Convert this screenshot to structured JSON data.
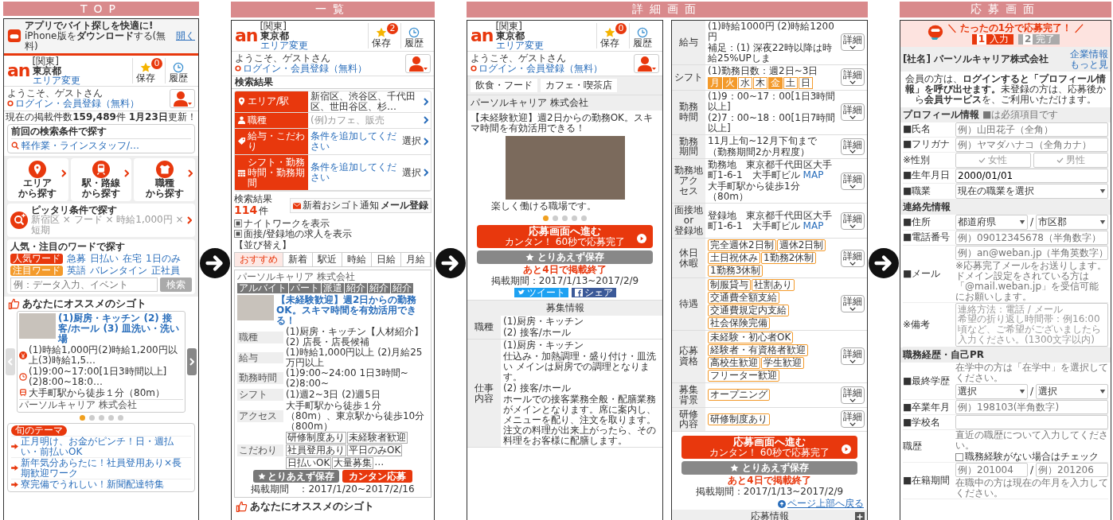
{
  "top": {
    "heading": "TOP",
    "app_banner": {
      "title": "**アプリ**でバイト探しを快適に!",
      "subtitle": "iPhone版を**ダウンロード**する(無料)",
      "open_link": "開く"
    },
    "header": {
      "logo": "an",
      "region": "[関東]",
      "prefecture": "東京都",
      "change_area": "エリア変更",
      "saved_count": "0",
      "saved_label": "保存",
      "history_label": "履歴"
    },
    "welcome": {
      "greeting": "ようこそ、ゲストさん",
      "login_link": "ログイン・会員登録（無料）"
    },
    "listing_count": "現在の掲載件数**159,489**件 **1月23日**更新！",
    "previous_search": {
      "title": "前回の検索条件で探す",
      "link": "軽作業・ラインスタッフ/…"
    },
    "search_tiles": [
      {
        "kind": "area",
        "lines": [
          "エリア",
          "から探す"
        ]
      },
      {
        "kind": "station",
        "lines": [
          "駅・路線",
          "から探す"
        ]
      },
      {
        "kind": "job",
        "lines": [
          "職種",
          "から探す"
        ]
      }
    ],
    "match_search": {
      "title": "ピッタリ条件で探す",
      "example": "新宿区 × フード × 時給1,000円 × 短期"
    },
    "popular_words": {
      "title": "人気・注目のワードで探す",
      "groups": [
        {
          "label": "人気ワード",
          "color": "#e8380d",
          "words": [
            "急募",
            "日払い",
            "在宅",
            "1日のみ"
          ]
        },
        {
          "label": "注目ワード",
          "color": "#f39a2b",
          "words": [
            "英語",
            "バレンタイン",
            "正社員"
          ]
        }
      ],
      "placeholder": "例：データ入力、イベント",
      "button": "検索"
    },
    "recommend": {
      "title": "あなたにオススメのシゴト",
      "job_title": "(1)厨房・キッチン (2) 接客/ホール (3) 皿洗い・洗い場",
      "info": [
        {
          "kind": "pay",
          "text": "(1)時給1,000円(2)時給1,200円以上(3)時給1,5…"
        },
        {
          "kind": "time",
          "text": "(1)9:00~17:00[1日3時間以上](2)8:00~18:0…"
        },
        {
          "kind": "access",
          "text": "大手町駅から徒歩１分（80m）"
        }
      ],
      "company": "パーソルキャリア 株式会社",
      "dots": [
        {
          "selected": true
        },
        {
          "selected": false
        },
        {
          "selected": false
        },
        {
          "selected": false
        },
        {
          "selected": false
        }
      ]
    },
    "themes": {
      "title": "旬のテーマ",
      "items": [
        "正月明け、お金がピンチ！日・週払い・前払いOK",
        "新年気分あらたに！社員登用あり×長期歓迎ワーク",
        "寮完備でうれしい！新聞配達特集"
      ]
    }
  },
  "list": {
    "heading": "一覧",
    "header": {
      "logo": "an",
      "region": "[関東]",
      "prefecture": "東京都",
      "change_area": "エリア変更",
      "saved_count": "2",
      "saved_label": "保存",
      "history_label": "履歴"
    },
    "welcome": {
      "greeting": "ようこそ、ゲストさん",
      "login_link": "ログイン・会員登録（無料）"
    },
    "title": "検索結果",
    "filters": [
      {
        "kind": "area",
        "label": "エリア/駅",
        "value": "新宿区、渋谷区、千代田区、世田谷区、杉…"
      },
      {
        "kind": "job",
        "label": "職種",
        "placeholder": "(例)カフェ、販売"
      },
      {
        "kind": "pay",
        "label": "給与・こだわり",
        "value": "条件を追加してください",
        "action": "選択"
      },
      {
        "kind": "shift",
        "label": "シフト・勤務時間・勤務期間",
        "value": "条件を追加してください",
        "action": "選択"
      }
    ],
    "result_label": "検索結果",
    "result_count": "114",
    "result_unit": "件",
    "mail_button": "新着おシゴト通知**メール登録**",
    "options": [
      {
        "label": "ナイトワークを表示",
        "checked": true
      },
      {
        "label": "面接/登録地の求人を表示",
        "checked": true
      }
    ],
    "sort_label": "【並び替え】",
    "sort_tabs": [
      {
        "label": "おすすめ",
        "selected": true
      },
      {
        "label": "新着",
        "selected": false
      },
      {
        "label": "駅近",
        "selected": false
      },
      {
        "label": "時給",
        "selected": false
      },
      {
        "label": "日給",
        "selected": false
      },
      {
        "label": "月給",
        "selected": false
      }
    ],
    "job": {
      "company": "パーソルキャリア 株式会社",
      "tags": [
        "アルバイト",
        "パート",
        "派遣",
        "紹介",
        "紹介",
        "紹介"
      ],
      "title": "【未経験歓迎】週2日からの勤務OK。スキマ時間を有効活用できる！",
      "rows": [
        {
          "kind": "job",
          "label": "職種",
          "text": "(1)厨房・キッチン【人材紹介】(2) 店長・店長候補"
        },
        {
          "kind": "pay",
          "label": "給与",
          "text": "(1)時給1,000円以上 (2)月給25万円以上"
        },
        {
          "kind": "time",
          "label": "勤務時間",
          "text": "(1)9:00~24:00 1日3時間~ (2)8:00~"
        },
        {
          "kind": "shift",
          "label": "シフト",
          "text": "(1)週2~3日 (2)週5日"
        },
        {
          "kind": "access",
          "label": "アクセス",
          "text": "大手町駅から徒歩１分（80m）、東京駅から徒歩10分（800m）"
        },
        {
          "kind": "features",
          "label": "こだわり",
          "tags": [
            "研修制度あり",
            "未経験者歓迎",
            "社員登用あり",
            "平日のみOK",
            "日払いOK",
            "大量募集"
          ],
          "more": "…"
        }
      ],
      "save_button": "とりあえず保存",
      "apply_button": "カンタン応募",
      "period": "掲載期間　：2017/1/20~2017/2/16"
    },
    "recommend_title": "あなたにオススメのシゴト"
  },
  "detail": {
    "heading": "詳細画面",
    "header": {
      "logo": "an",
      "region": "[関東]",
      "prefecture": "東京都",
      "change_area": "エリア変更",
      "saved_count": "0",
      "saved_label": "保存",
      "history_label": "履歴"
    },
    "welcome": {
      "greeting": "ようこそ、ゲストさん",
      "login_link": "ログイン・会員登録（無料）"
    },
    "breadcrumbs": [
      "飲食・フード",
      "カフェ・喫茶店"
    ],
    "company": "パーソルキャリア 株式会社",
    "title": "【未経験歓迎】週2日からの勤務OK。スキマ時間を有効活用できる！",
    "photo_caption": "楽しく働ける職場です。",
    "dots": [
      {
        "selected": true
      },
      {
        "selected": false
      },
      {
        "selected": false
      },
      {
        "selected": false
      },
      {
        "selected": false
      }
    ],
    "apply_button": {
      "title": "応募画面へ進む",
      "subtitle": "カンタン！ 60秒で応募完了"
    },
    "save_button": "とりあえず保存",
    "remaining": "あと**4**日で掲載終了",
    "period": "掲載期間：2017/1/13~2017/2/9",
    "share": [
      {
        "kind": "twitter",
        "label": "ツイート"
      },
      {
        "kind": "facebook",
        "label": "シェア"
      }
    ],
    "table_title": "募集情報",
    "rows": [
      {
        "label": [
          "職種"
        ],
        "lines": [
          "(1)厨房・キッチン",
          "(2) 接客/ホール"
        ]
      },
      {
        "label": [
          "仕事",
          "内容"
        ],
        "lines": [
          "(1)厨房・キッチン",
          "仕込み・加熱調理・盛り付け・皿洗い メインは厨房での調理となります。",
          "(2) 接客/ホール",
          "ホールでの接客業務全般・配膳業務がメインとなります。席に案内し、メニューを配り、注文を取ります。注文の料理が出来上がったら、その料理をお客様に配膳します。"
        ]
      }
    ],
    "more_rows": [
      {
        "kind": "text",
        "label": [
          "給与"
        ],
        "lines": [
          "(1)時給1000円 (2)時給1200円",
          "補足：(1) 深夜22時以降は時給25%UPしま"
        ],
        "detail_button": "詳細"
      },
      {
        "kind": "shift",
        "label": [
          "シフト"
        ],
        "lines": [
          "(1)勤務日数：週2日~3日"
        ],
        "days": [
          {
            "label": "月",
            "on": true
          },
          {
            "label": "火",
            "on": true
          },
          {
            "label": "水",
            "on": false
          },
          {
            "label": "木",
            "on": false
          },
          {
            "label": "金",
            "on": true
          },
          {
            "label": "土",
            "on": false
          },
          {
            "label": "日",
            "on": false
          }
        ],
        "detail_button": "詳細"
      },
      {
        "kind": "text",
        "label": [
          "勤務",
          "時間"
        ],
        "lines": [
          "(1)9：00~17：00[1日3時間以上]",
          "(2)7：00~18：00[1日7時間以上]"
        ],
        "detail_button": "詳細"
      },
      {
        "kind": "text",
        "label": [
          "勤務",
          "期間"
        ],
        "lines": [
          "11月上旬~12月下旬まで",
          "（勤務期間2か月程度）"
        ],
        "detail_button": "詳細"
      },
      {
        "kind": "address",
        "label": [
          "勤務地",
          "アク",
          "セス"
        ],
        "address": "勤務地　東京都千代田区大手町1-6-1　大手町ビル",
        "map_link": "MAP",
        "lines": [
          "大手町駅から徒歩1分（80m）"
        ],
        "detail_button": "詳細"
      },
      {
        "kind": "address",
        "label": [
          "面接地",
          "or",
          "登録地"
        ],
        "address": "登録地　東京都千代田区大手町1-6-1　大手町ビル",
        "map_link": "MAP",
        "lines": [],
        "detail_button": "詳細"
      },
      {
        "kind": "tags",
        "label": [
          "休日",
          "休暇"
        ],
        "tags": [
          "完全週休2日制",
          "週休2日制",
          "土日祝休み",
          "1勤務2休制",
          "1勤務3休制"
        ],
        "detail_button": "詳細"
      },
      {
        "kind": "tags",
        "label": [
          "待遇"
        ],
        "tags": [
          "制服貸与",
          "社割あり",
          "交通費全額支給",
          "交通費規定内支給",
          "社会保険完備"
        ],
        "detail_button": "詳細"
      },
      {
        "kind": "tags",
        "label": [
          "応募",
          "資格"
        ],
        "tags": [
          "未経験・初心者OK",
          "経験者・有資格者歓迎",
          "高校生歓迎",
          "学生歓迎",
          "フリーター歓迎"
        ],
        "detail_button": "詳細"
      },
      {
        "kind": "tags",
        "label": [
          "募集",
          "背景"
        ],
        "tags": [
          "オープニング"
        ],
        "detail_button": "詳細"
      },
      {
        "kind": "tags",
        "label": [
          "研修",
          "内容"
        ],
        "tags": [
          "研修制度あり"
        ],
        "detail_button": "詳細"
      }
    ],
    "bottom": {
      "apply_button": {
        "title": "応募画面へ進む",
        "subtitle": "カンタン！ 60秒で応募完了"
      },
      "save_button": "とりあえず保存",
      "remaining": "あと**4**日で掲載終了",
      "period": "掲載期間：2017/1/13~2017/2/9",
      "back_to_top": "ページ上部へ戻る",
      "section_title": "応募情報"
    }
  },
  "apply": {
    "heading": "応募画面",
    "banner": "＼ たったの1分で応募完了！ ／",
    "steps": [
      {
        "number": "1",
        "label": "入力",
        "selected": true
      },
      {
        "number": "2",
        "label": "完了",
        "selected": false
      }
    ],
    "company": "[社名] パーソルキャリア株式会社",
    "company_link": [
      "企業情報",
      "もっと見"
    ],
    "notice": "会員の方は、**ログインすると「プロフィール情報」を呼び出せます。**未登録の方は、応募後から**会員サービス**を、ご利用いただけます。",
    "sections": [
      {
        "title": "プロフィール情報",
        "note": "■は必須項目です",
        "fields": [
          {
            "kind": "text",
            "label": "■氏名",
            "placeholder": "例）山田花子（全角）"
          },
          {
            "kind": "text",
            "label": "■フリガナ",
            "placeholder": "例）ヤマダハナコ（全角カナ）"
          },
          {
            "kind": "choice",
            "label": "※性別",
            "options": [
              {
                "label": "女性",
                "selected": false
              },
              {
                "label": "男性",
                "selected": false
              }
            ]
          },
          {
            "kind": "text",
            "label": "■生年月日",
            "value": "2000/01/01"
          },
          {
            "kind": "select",
            "label": "■職業",
            "values": [
              "現在の職業を選択"
            ]
          }
        ]
      },
      {
        "title": "連絡先情報",
        "fields": [
          {
            "kind": "select",
            "label": "■住所",
            "values": [
              "都道府県",
              "市区郡"
            ],
            "separator": "/"
          },
          {
            "kind": "text",
            "label": "■電話番号",
            "placeholder": "例）09012345678（半角数字）"
          },
          {
            "kind": "text",
            "label": "■メール",
            "placeholder": "例）an@weban.jp（半角英数字）",
            "note": "※応募完了メールをお送りします。ドメイン設定をされている方は「@mail.weban.jp」を受信可能にお願いします。"
          },
          {
            "kind": "textarea",
            "label": "※備考",
            "placeholder": [
              "連絡方法：電話 / メール",
              "希望の折り返し時間帯：例16:00頃など、ご希望がございましたら入力ください。(1300文字以内)"
            ]
          }
        ]
      },
      {
        "title": "職務経歴・自己PR",
        "fields": [
          {
            "kind": "select",
            "label": "■最終学歴",
            "hint": "在学中の方は「在学中」を選択してください。",
            "values": [
              "選択",
              "選択"
            ],
            "separator": "/"
          },
          {
            "kind": "text",
            "label": "■卒業年月",
            "placeholder": "例）198103(半角数字)"
          },
          {
            "kind": "text",
            "label": "■学校名"
          },
          {
            "kind": "checkbox",
            "label": "職歴",
            "hint": "直近の職歴について入力してください。",
            "option": "職務経験がない場合はチェック",
            "checked": false
          },
          {
            "kind": "range",
            "label": "■在籍期間",
            "placeholders": [
              "例）201004",
              "例）201206"
            ],
            "separator": "/",
            "note": "在職中の方は現在の年月を入力してください。"
          }
        ]
      }
    ]
  }
}
